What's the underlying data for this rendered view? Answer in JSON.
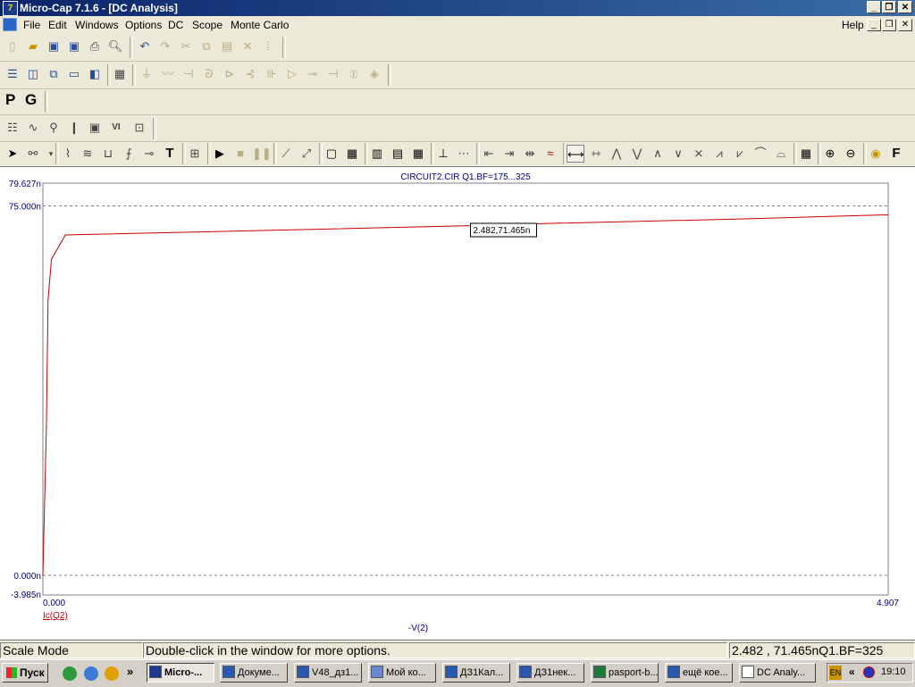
{
  "window": {
    "title": "Micro-Cap 7.1.6 - [DC Analysis]",
    "logo_text": "7"
  },
  "menu": {
    "items": [
      "File",
      "Edit",
      "Windows",
      "Options",
      "DC",
      "Scope",
      "Monte Carlo"
    ],
    "help": "Help"
  },
  "toolbar": {
    "p_label": "P",
    "g_label": "G",
    "text_tool_label": "T",
    "font_tool_label": "F"
  },
  "plot": {
    "header": "CIRCUIT2.CIR Q1.BF=175...325",
    "ytick_top": "79.627n",
    "ytick_75": "75.000n",
    "ytick_0": "0.000n",
    "ytick_bottom": "-3.985n",
    "xtick_left": "0.000",
    "xtick_right": "4.907",
    "xlabel": "-V(2)",
    "trace_label": "Ic(Q2)",
    "cursor_label": "2.482,71.465n"
  },
  "chart_data": {
    "type": "line",
    "title": "CIRCUIT2.CIR Q1.BF=175...325",
    "xlabel": "-V(2)",
    "ylabel": "Ic(Q2)",
    "xlim": [
      0,
      4.907
    ],
    "ylim": [
      -3.985,
      79.627
    ],
    "grid_lines_y": [
      0,
      75
    ],
    "series": [
      {
        "name": "Ic(Q2)",
        "color": "#c80000",
        "x": [
          0.0,
          0.02,
          0.03,
          0.05,
          0.13,
          1.0,
          2.0,
          2.482,
          3.0,
          4.0,
          4.907
        ],
        "y": [
          0.0,
          30.0,
          56.0,
          64.2,
          69.1,
          69.8,
          70.6,
          71.0,
          71.5,
          72.3,
          73.2
        ]
      }
    ],
    "cursor": {
      "x": 2.482,
      "y": 71.465
    }
  },
  "status": {
    "mode": "Scale Mode",
    "hint": "Double-click in the window for more options.",
    "readout": "2.482 , 71.465nQ1.BF=325"
  },
  "taskbar": {
    "start": "Пуск",
    "chevron": "»",
    "tasks": [
      "Micro-...",
      "Докуме...",
      "V48_дз1...",
      "Мой ко...",
      "ДЗ1Кал...",
      "ДЗ1нек...",
      "pasport-b...",
      "ещё кое...",
      "DC Analy..."
    ],
    "lang": "EN",
    "tray_chevron": "«",
    "clock": "19:10"
  },
  "colors": {
    "titlebar": "#0a246a",
    "trace": "#c80000",
    "axis_text": "#00008b"
  }
}
